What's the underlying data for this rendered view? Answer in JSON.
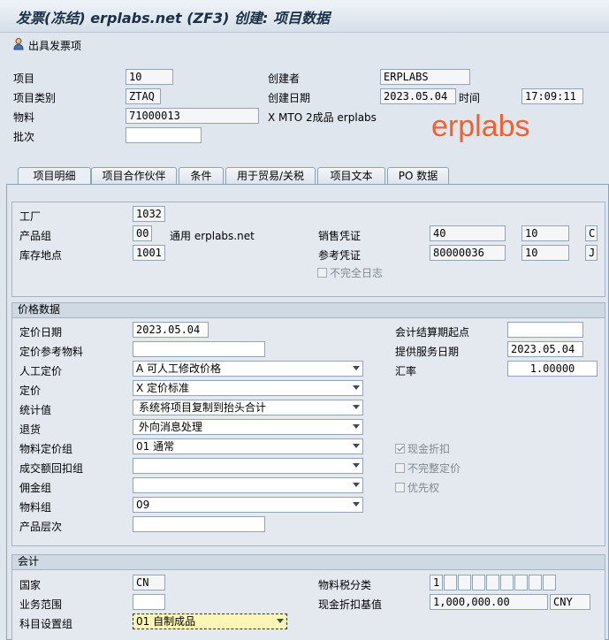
{
  "title": "发票(冻结) erplabs.net (ZF3) 创建: 项目数据",
  "toolbar": {
    "issue_invoice_label": "出具发票项"
  },
  "watermark": "erplabs",
  "header": {
    "item_label": "项目",
    "item_value": "10",
    "item_cat_label": "项目类别",
    "item_cat_value": "ZTAQ",
    "material_label": "物料",
    "material_value": "71000013",
    "material_desc": "X MTO 2成品 erplabs",
    "batch_label": "批次",
    "batch_value": "",
    "created_by_label": "创建者",
    "created_by_value": "ERPLABS",
    "created_on_label": "创建日期",
    "created_on_value": "2023.05.04",
    "time_label": "时间",
    "time_value": "17:09:11"
  },
  "tabs": [
    {
      "label": "项目明细"
    },
    {
      "label": "项目合作伙伴"
    },
    {
      "label": "条件"
    },
    {
      "label": "用于贸易/关税"
    },
    {
      "label": "项目文本"
    },
    {
      "label": "PO 数据"
    }
  ],
  "detail": {
    "plant_label": "工厂",
    "plant_value": "1032",
    "division_label": "产品组",
    "division_value": "00",
    "division_desc": "通用 erplabs.net",
    "sloc_label": "库存地点",
    "sloc_value": "1001",
    "sales_doc_label": "销售凭证",
    "sales_doc_value": "40",
    "sales_doc_item": "10",
    "sales_doc_cat": "C",
    "ref_doc_label": "参考凭证",
    "ref_doc_value": "80000036",
    "ref_doc_item": "10",
    "ref_doc_cat": "J",
    "incomplete_log_label": "不完全日志"
  },
  "pricing": {
    "group_title": "价格数据",
    "pricing_date_label": "定价日期",
    "pricing_date_value": "2023.05.04",
    "pricing_ref_mat_label": "定价参考物料",
    "pricing_ref_mat_value": "",
    "manual_pricing_label": "人工定价",
    "manual_pricing_value": "A 可人工修改价格",
    "pricing_label": "定价",
    "pricing_value": "X 定价标准",
    "stat_value_label": "统计值",
    "stat_value_value": "系统将项目复制到抬头合计",
    "return_label": "退货",
    "return_value": "外向消息处理",
    "mat_price_grp_label": "物料定价组",
    "mat_price_grp_value": "01 通常",
    "rebate_grp_label": "成交额回扣组",
    "rebate_grp_value": "",
    "commission_grp_label": "佣金组",
    "commission_grp_value": "",
    "mat_grp_label": "物料组",
    "mat_grp_value": "09",
    "prod_hier_label": "产品层次",
    "prod_hier_value": "",
    "settle_start_label": "会计结算期起点",
    "settle_start_value": "",
    "service_date_label": "提供服务日期",
    "service_date_value": "2023.05.04",
    "exch_rate_label": "汇率",
    "exch_rate_value": "1.00000",
    "cash_discount_label": "现金折扣",
    "incomplete_pricing_label": "不完整定价",
    "priority_label": "优先权"
  },
  "accounting": {
    "group_title": "会计",
    "country_label": "国家",
    "country_value": "CN",
    "business_area_label": "业务范围",
    "business_area_value": "",
    "acct_assign_grp_label": "科目设置组",
    "acct_assign_grp_value": "01 自制成品",
    "tax_class_label": "物料税分类",
    "tax_class_value": "1",
    "cash_disc_base_label": "现金折扣基值",
    "cash_disc_base_value": "1,000,000.00",
    "currency_value": "CNY"
  },
  "colors": {
    "watermark": "#f06030",
    "accent_header": "#cfd9e3"
  }
}
